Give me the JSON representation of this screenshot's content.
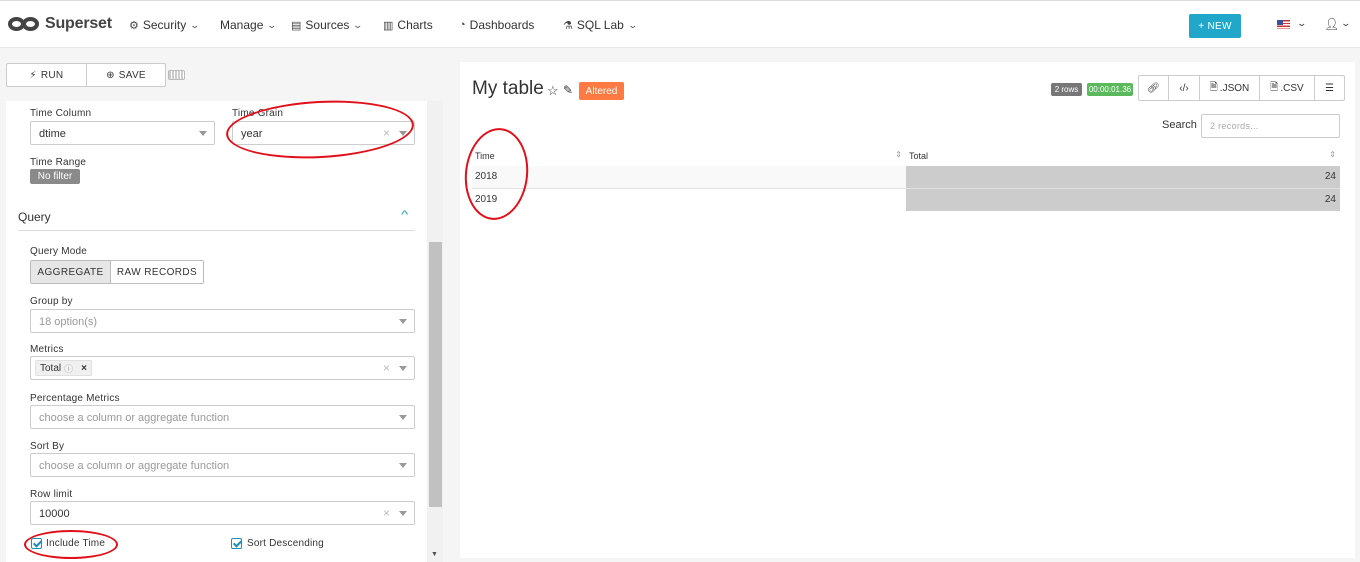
{
  "nav": {
    "brand": "Superset",
    "items": [
      {
        "label": "Security",
        "icon": "⚙",
        "icon_name": "gears-icon",
        "dropdown": true
      },
      {
        "label": "Manage",
        "icon": "",
        "icon_name": "",
        "dropdown": true
      },
      {
        "label": "Sources",
        "icon": "▤",
        "icon_name": "database-icon",
        "dropdown": true
      },
      {
        "label": "Charts",
        "icon": "▥",
        "icon_name": "bar-chart-icon",
        "dropdown": false
      },
      {
        "label": "Dashboards",
        "icon": "◔",
        "icon_name": "dashboard-icon",
        "dropdown": false
      },
      {
        "label": "SQL Lab",
        "icon": "⚗",
        "icon_name": "flask-icon",
        "dropdown": true
      }
    ],
    "new_button": "+ NEW",
    "accent": "#20a7c9"
  },
  "toolbar": {
    "run": "RUN",
    "save": "SAVE"
  },
  "controls": {
    "time_column_label": "Time Column",
    "time_column_value": "dtime",
    "time_grain_label": "Time Grain",
    "time_grain_value": "year",
    "time_range_label": "Time Range",
    "time_range_value": "No filter",
    "query_section": "Query",
    "query_mode_label": "Query Mode",
    "query_mode_aggregate": "AGGREGATE",
    "query_mode_raw": "RAW RECORDS",
    "group_by_label": "Group by",
    "group_by_placeholder": "18 option(s)",
    "metrics_label": "Metrics",
    "metric_tag": "Total",
    "percentage_metrics_label": "Percentage Metrics",
    "percentage_metrics_placeholder": "choose a column or aggregate function",
    "sort_by_label": "Sort By",
    "sort_by_placeholder": "choose a column or aggregate function",
    "row_limit_label": "Row limit",
    "row_limit_value": "10000",
    "include_time_label": "Include Time",
    "sort_descending_label": "Sort Descending"
  },
  "chart": {
    "title": "My table",
    "altered_label": "Altered",
    "altered_color": "#fe7a43",
    "rows_badge": "2 rows",
    "time_badge": "00:00:01.36",
    "actions": [
      ".JSON",
      ".CSV"
    ],
    "search_label": "Search",
    "search_placeholder": "2 records..."
  },
  "table": {
    "columns": [
      "Time",
      "Total"
    ],
    "rows": [
      {
        "time": "2018",
        "total": "24"
      },
      {
        "time": "2019",
        "total": "24"
      }
    ]
  }
}
